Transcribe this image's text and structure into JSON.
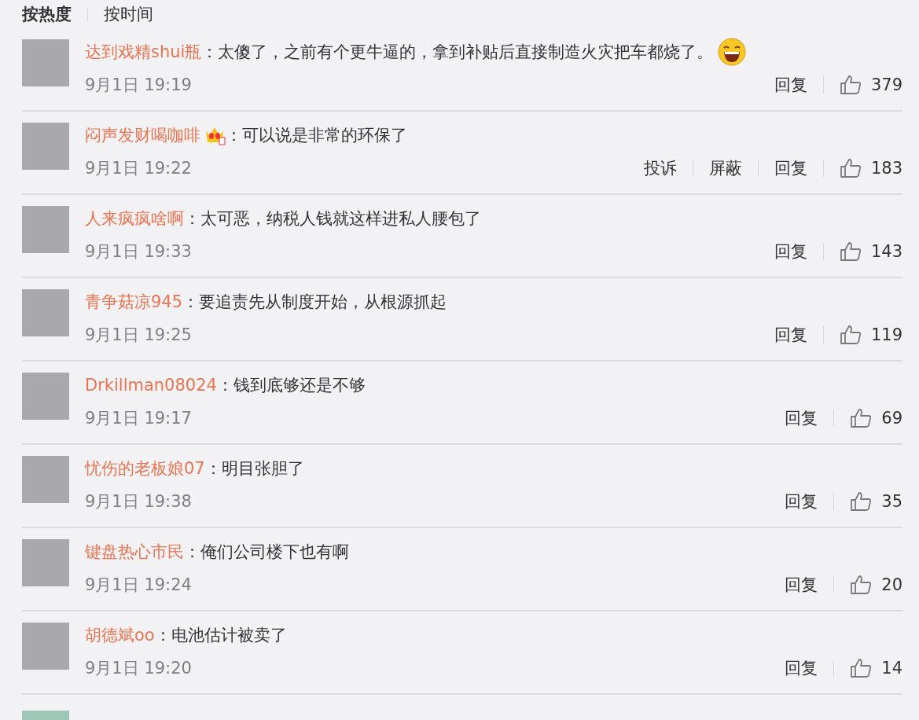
{
  "sort_tabs": [
    {
      "label": "按热度",
      "selected": true
    },
    {
      "label": "按时间",
      "selected": false
    }
  ],
  "comments": [
    {
      "user": "达到戏精shui瓶",
      "crown_badge": false,
      "separator": "：",
      "text": "太傻了，之前有个更牛逼的，拿到补贴后直接制造火灾把车都烧了。",
      "emoji": true,
      "date": "9月1日 19:19",
      "actions": [
        "回复"
      ],
      "likes": "379"
    },
    {
      "user": "闷声发财喝咖啡",
      "crown_badge": true,
      "separator": "：",
      "text": "可以说是非常的环保了",
      "emoji": false,
      "date": "9月1日 19:22",
      "actions": [
        "投诉",
        "屏蔽",
        "回复"
      ],
      "likes": "183"
    },
    {
      "user": "人来疯疯啥啊",
      "crown_badge": false,
      "separator": "：",
      "text": "太可恶，纳税人钱就这样进私人腰包了",
      "emoji": false,
      "date": "9月1日 19:33",
      "actions": [
        "回复"
      ],
      "likes": "143"
    },
    {
      "user": "青争菇凉945",
      "crown_badge": false,
      "separator": "：",
      "text": "要追责先从制度开始，从根源抓起",
      "emoji": false,
      "date": "9月1日 19:25",
      "actions": [
        "回复"
      ],
      "likes": "119"
    },
    {
      "user": "Drkillman08024",
      "crown_badge": false,
      "separator": "：",
      "text": "钱到底够还是不够",
      "emoji": false,
      "date": "9月1日 19:17",
      "actions": [
        "回复"
      ],
      "likes": "69"
    },
    {
      "user": "忧伤的老板娘07",
      "crown_badge": false,
      "separator": "：",
      "text": "明目张胆了",
      "emoji": false,
      "date": "9月1日 19:38",
      "actions": [
        "回复"
      ],
      "likes": "35"
    },
    {
      "user": "键盘热心市民",
      "crown_badge": false,
      "separator": "：",
      "text": "俺们公司楼下也有啊",
      "emoji": false,
      "date": "9月1日 19:24",
      "actions": [
        "回复"
      ],
      "likes": "20"
    },
    {
      "user": "胡德斌oo",
      "crown_badge": false,
      "separator": "：",
      "text": "电池估计被卖了",
      "emoji": false,
      "date": "9月1日 19:20",
      "actions": [
        "回复"
      ],
      "likes": "14"
    }
  ]
}
